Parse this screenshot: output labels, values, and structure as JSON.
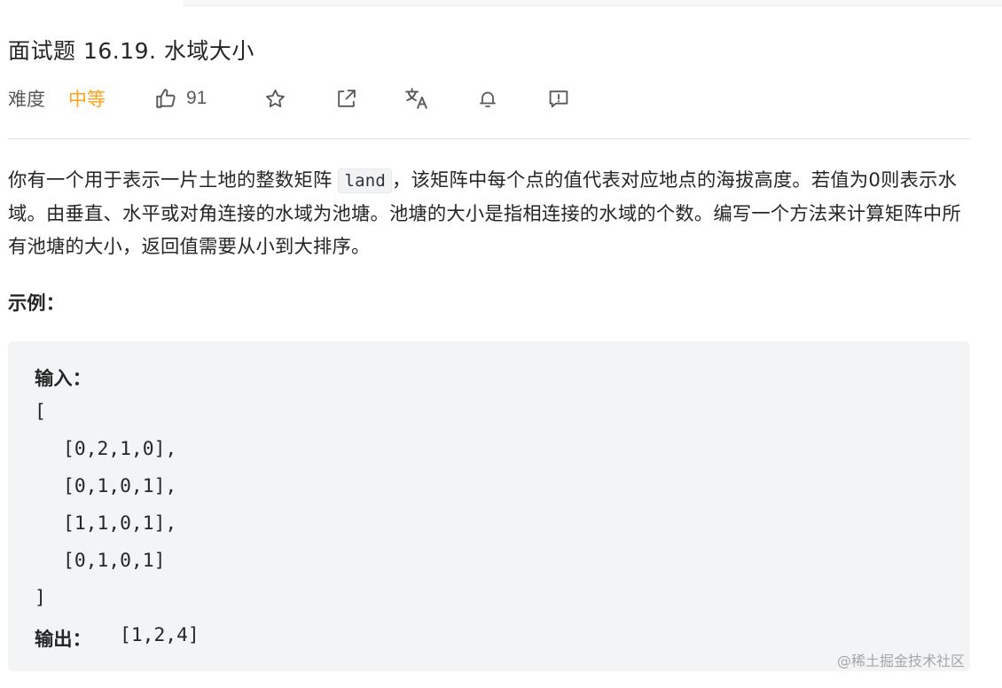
{
  "problem": {
    "title": "面试题 16.19. 水域大小",
    "difficulty_label": "难度",
    "difficulty_value": "中等",
    "likes": "91",
    "difficulty_color": "#ffa116"
  },
  "icons": [
    "thumbs-up-icon",
    "star-icon",
    "share-icon",
    "translate-icon",
    "bell-icon",
    "feedback-icon"
  ],
  "description": {
    "part1": "你有一个用于表示一片土地的整数矩阵",
    "code": "land",
    "part2": "，该矩阵中每个点的值代表对应地点的海拔高度。若值为0则表示水域。由垂直、水平或对角连接的水域为池塘。池塘的大小是指相连接的水域的个数。编写一个方法来计算矩阵中所有池塘的大小，返回值需要从小到大排序。"
  },
  "example": {
    "heading": "示例：",
    "input_label": "输入：",
    "open_bracket": "[",
    "rows": [
      "[0,2,1,0],",
      "[0,1,0,1],",
      "[1,1,0,1],",
      "[0,1,0,1]"
    ],
    "close_bracket": "]",
    "output_label": "输出：",
    "output_value": "[1,2,4]"
  },
  "watermark": "@稀土掘金技术社区"
}
